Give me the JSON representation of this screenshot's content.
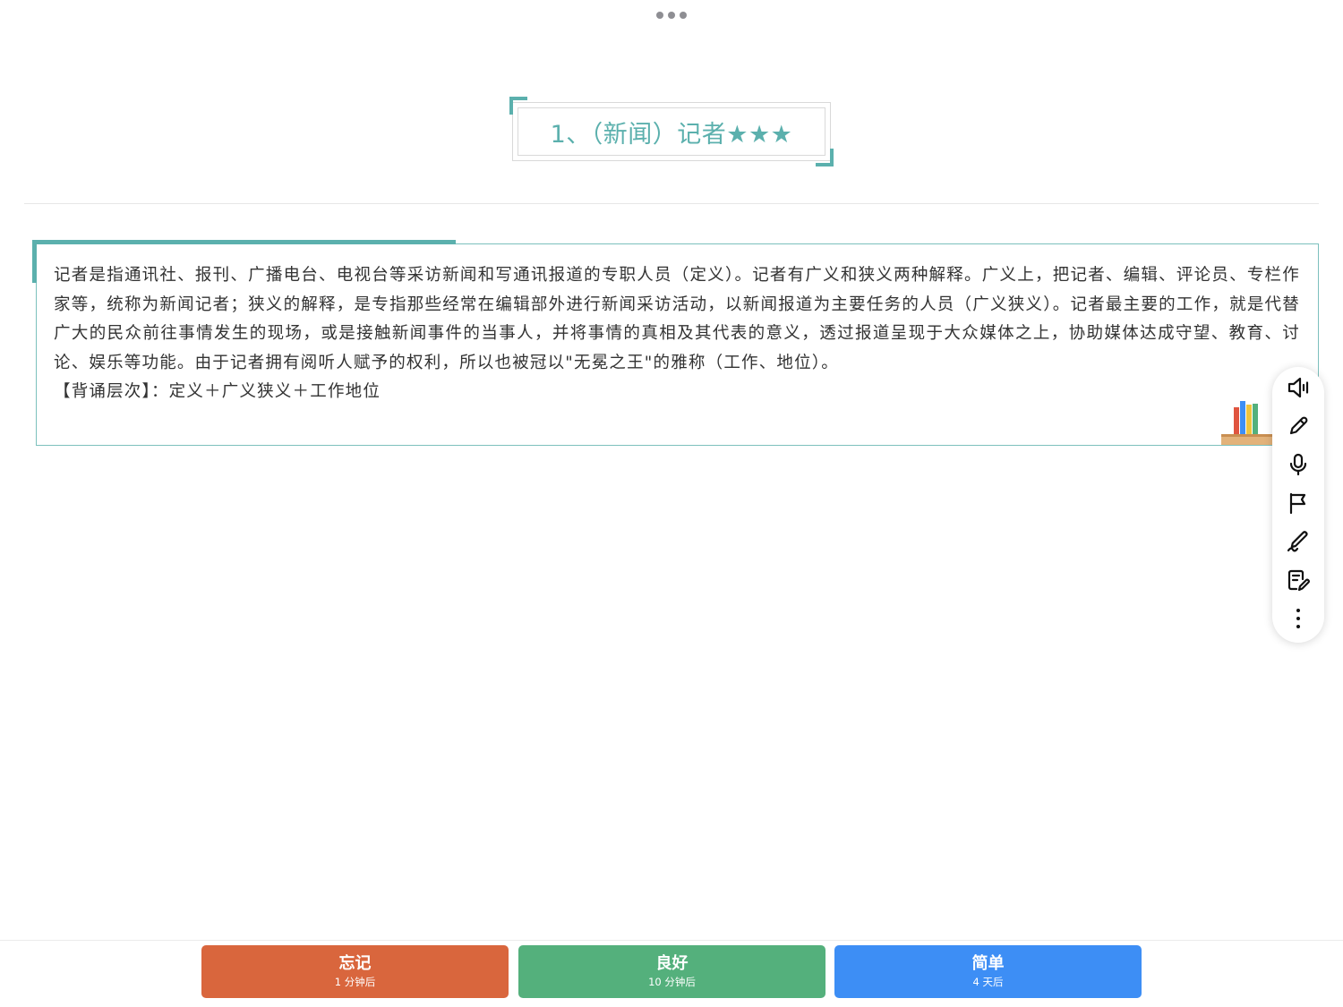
{
  "card": {
    "title": "1、（新闻）记者★★★",
    "paragraph": "记者是指通讯社、报刊、广播电台、电视台等采访新闻和写通讯报道的专职人员（定义）。记者有广义和狭义两种解释。广义上，把记者、编辑、评论员、专栏作家等，统称为新闻记者；狭义的解释，是专指那些经常在编辑部外进行新闻采访活动，以新闻报道为主要任务的人员（广义狭义）。记者最主要的工作，就是代替广大的民众前往事情发生的现场，或是接触新闻事件的当事人，并将事情的真相及其代表的意义，透过报道呈现于大众媒体之上，协助媒体达成守望、教育、讨论、娱乐等功能。由于记者拥有阅听人赋予的权利，所以也被冠以\"无冕之王\"的雅称（工作、地位）。",
    "recite_level": "【背诵层次】：定义＋广义狭义＋工作地位"
  },
  "side_toolbar": {
    "icons": [
      "speaker-icon",
      "pencil-icon",
      "microphone-icon",
      "flag-icon",
      "signature-icon",
      "note-edit-icon",
      "more-vertical-icon"
    ]
  },
  "rating_buttons": {
    "forget": {
      "label": "忘记",
      "interval": "1 分钟后",
      "color": "#d9663d"
    },
    "good": {
      "label": "良好",
      "interval": "10 分钟后",
      "color": "#54b07c"
    },
    "easy": {
      "label": "简单",
      "interval": "4 天后",
      "color": "#3d8ef5"
    }
  },
  "colors": {
    "accent": "#5bb0ad",
    "border": "#7cc0bd"
  }
}
